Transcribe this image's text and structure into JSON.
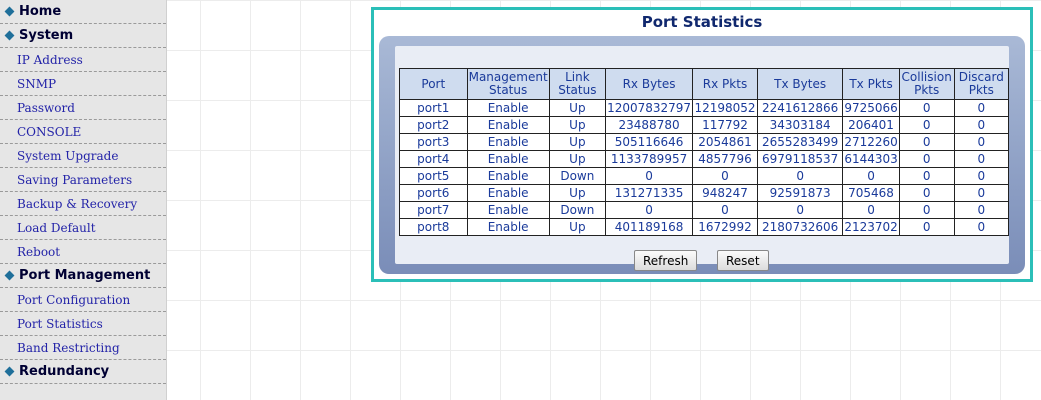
{
  "sidebar": {
    "items": [
      {
        "label": "Home",
        "type": "category"
      },
      {
        "label": "System",
        "type": "category"
      },
      {
        "label": "IP Address",
        "type": "link"
      },
      {
        "label": "SNMP",
        "type": "link"
      },
      {
        "label": "Password",
        "type": "link"
      },
      {
        "label": "CONSOLE",
        "type": "link"
      },
      {
        "label": "System Upgrade",
        "type": "link"
      },
      {
        "label": "Saving Parameters",
        "type": "link"
      },
      {
        "label": "Backup & Recovery",
        "type": "link"
      },
      {
        "label": "Load Default",
        "type": "link"
      },
      {
        "label": "Reboot",
        "type": "link"
      },
      {
        "label": "Port Management",
        "type": "category"
      },
      {
        "label": "Port Configuration",
        "type": "link"
      },
      {
        "label": "Port Statistics",
        "type": "link"
      },
      {
        "label": "Band Restricting",
        "type": "link"
      },
      {
        "label": "Redundancy",
        "type": "category"
      }
    ]
  },
  "panel": {
    "title": "Port Statistics",
    "columns": [
      "Port",
      "Management Status",
      "Link Status",
      "Rx Bytes",
      "Rx Pkts",
      "Tx Bytes",
      "Tx Pkts",
      "Collision Pkts",
      "Discard Pkts"
    ],
    "rows": [
      [
        "port1",
        "Enable",
        "Up",
        "12007832797",
        "12198052",
        "2241612866",
        "9725066",
        "0",
        "0"
      ],
      [
        "port2",
        "Enable",
        "Up",
        "23488780",
        "117792",
        "34303184",
        "206401",
        "0",
        "0"
      ],
      [
        "port3",
        "Enable",
        "Up",
        "505116646",
        "2054861",
        "2655283499",
        "2712260",
        "0",
        "0"
      ],
      [
        "port4",
        "Enable",
        "Up",
        "1133789957",
        "4857796",
        "6979118537",
        "6144303",
        "0",
        "0"
      ],
      [
        "port5",
        "Enable",
        "Down",
        "0",
        "0",
        "0",
        "0",
        "0",
        "0"
      ],
      [
        "port6",
        "Enable",
        "Up",
        "131271335",
        "948247",
        "92591873",
        "705468",
        "0",
        "0"
      ],
      [
        "port7",
        "Enable",
        "Down",
        "0",
        "0",
        "0",
        "0",
        "0",
        "0"
      ],
      [
        "port8",
        "Enable",
        "Up",
        "401189168",
        "1672992",
        "2180732606",
        "2123702",
        "0",
        "0"
      ]
    ],
    "buttons": {
      "refresh": "Refresh",
      "reset": "Reset"
    }
  },
  "colors": {
    "panel_border": "#2bbfb8",
    "title_text": "#10286e",
    "nav_link": "#2323a8",
    "table_text": "#1a3a9a",
    "nav_bullet": "#1f6f9a"
  },
  "icons": {
    "category_bullet": "diamond-icon"
  }
}
